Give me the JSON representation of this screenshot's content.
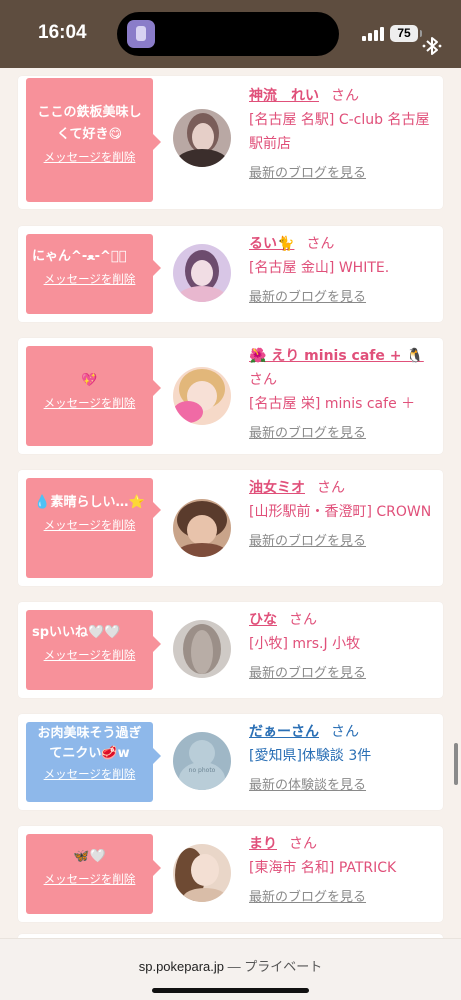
{
  "status_bar": {
    "time": "16:04",
    "battery": "75"
  },
  "favorites": [
    {
      "message": "ここの鉄板美味しくて好き😋",
      "delete_label": "メッセージを削除",
      "name": "神流　れい",
      "suffix": "さん",
      "shop": "[名古屋 名駅] C-club 名古屋駅前店",
      "link": "最新のブログを見る",
      "bubble_color": "#f7919a"
    },
    {
      "message": "にゃん^-ﻌ-^ฅ゙",
      "delete_label": "メッセージを削除",
      "name": "るい🐈",
      "suffix": "さん",
      "shop": "[名古屋 金山] WHITE.",
      "link": "最新のブログを見る",
      "bubble_color": "#f7919a"
    },
    {
      "message": "💖",
      "delete_label": "メッセージを削除",
      "name": "🌺 えり minis cafe + 🐧",
      "suffix": "さん",
      "shop": "[名古屋 栄] minis cafe ＋",
      "link": "最新のブログを見る",
      "bubble_color": "#f7919a"
    },
    {
      "message": "💧素晴らしい…⭐",
      "delete_label": "メッセージを削除",
      "name": "油女ミオ",
      "suffix": "さん",
      "shop": "[山形駅前・香澄町] CROWN",
      "link": "最新のブログを見る",
      "bubble_color": "#f7919a"
    },
    {
      "message": "spいいね🤍🤍",
      "delete_label": "メッセージを削除",
      "name": "ひな",
      "suffix": "さん",
      "shop": "[小牧] mrs.J 小牧",
      "link": "最新のブログを見る",
      "bubble_color": "#f7919a"
    },
    {
      "message": "お肉美味そう過ぎてニクい🥩w",
      "delete_label": "メッセージを削除",
      "name": "だぁーさん",
      "suffix": "さん",
      "shop": "[愛知県]体験談 3件",
      "link": "最新の体験談を見る",
      "avatar_text": "no photo",
      "bubble_color": "#8eb8ea"
    },
    {
      "message": "🦋🤍",
      "delete_label": "メッセージを削除",
      "name": "まり",
      "suffix": "さん",
      "shop": "[東海市 名和] PATRICK",
      "link": "最新のブログを見る",
      "bubble_color": "#f7919a"
    }
  ],
  "browser_bar": {
    "domain": "sp.pokepara.jp",
    "mode": "— プライベート"
  }
}
